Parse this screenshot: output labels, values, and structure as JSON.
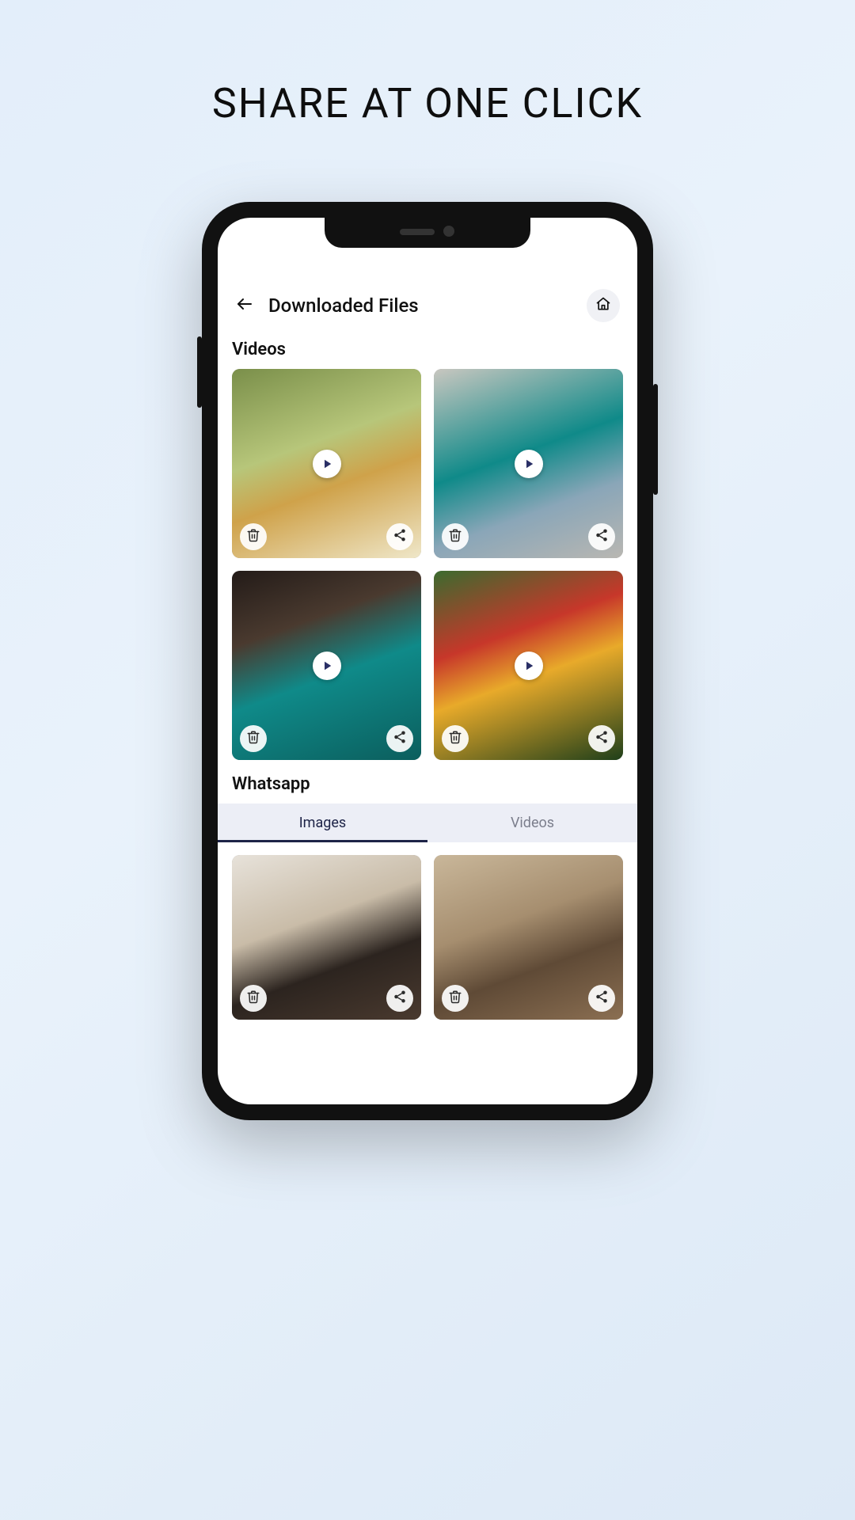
{
  "promo": {
    "headline": "SHARE AT ONE CLICK"
  },
  "header": {
    "title": "Downloaded Files"
  },
  "sections": {
    "videos": {
      "title": "Videos",
      "items": [
        {
          "thumb_class": "bg-a"
        },
        {
          "thumb_class": "bg-b"
        },
        {
          "thumb_class": "bg-c"
        },
        {
          "thumb_class": "bg-d"
        }
      ]
    },
    "whatsapp": {
      "title": "Whatsapp",
      "tabs": {
        "images": "Images",
        "videos": "Videos",
        "active": "images"
      },
      "images": [
        {
          "thumb_class": "bg-e"
        },
        {
          "thumb_class": "bg-f"
        }
      ]
    }
  },
  "icons": {
    "back": "back-arrow-icon",
    "home": "home-icon",
    "play": "play-icon",
    "trash": "trash-icon",
    "share": "share-icon"
  },
  "colors": {
    "accent": "#1d2347",
    "tab_bg": "#eceef6"
  }
}
